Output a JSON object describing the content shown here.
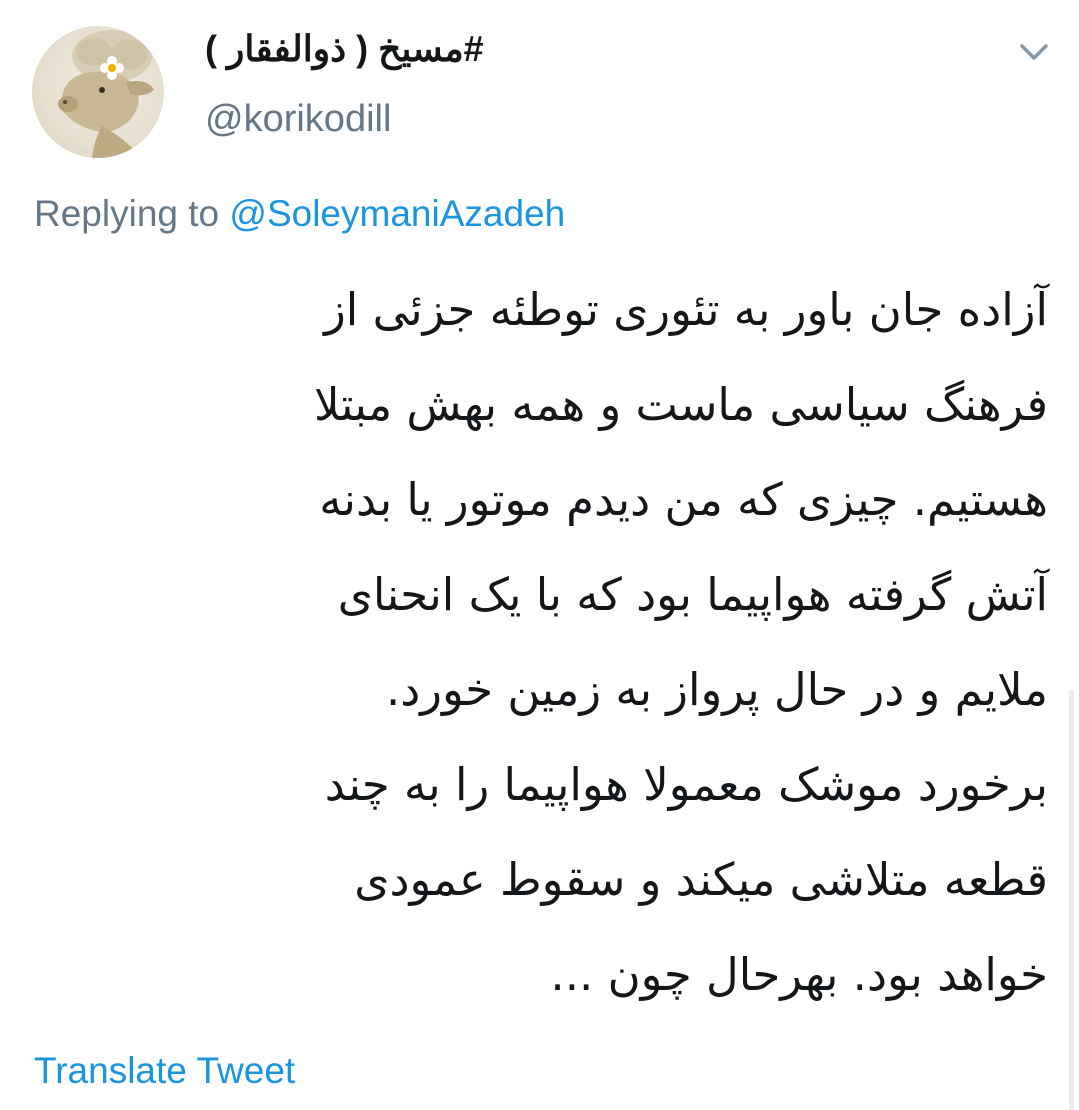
{
  "tweet": {
    "author": {
      "display_name": "#مسیخ ( ذوالفقار )",
      "handle": "@korikodill",
      "avatar_icon": "sheep-avatar-icon"
    },
    "menu_icon": "chevron-down-icon",
    "reply": {
      "prefix": "Replying to ",
      "mention": "@SoleymaniAzadeh"
    },
    "body_lines": [
      "آزاده جان باور به تئوری توطئه جزئی از",
      "فرهنگ سیاسی ماست و همه بهش مبتلا",
      "هستیم. چیزی که من دیدم موتور یا بدنه",
      "آتش گرفته هواپیما بود که با یک انحنای",
      "ملایم و در حال پرواز به زمین خورد.",
      "برخورد موشک معمولا هواپیما را به چند",
      "قطعه متلاشی میکند و سقوط عمودی",
      "خواهد بود. بهرحال چون ..."
    ],
    "translate_label": "Translate Tweet"
  },
  "colors": {
    "text_primary": "#14171a",
    "text_secondary": "#657786",
    "link": "#1b95e0",
    "background": "#ffffff"
  }
}
